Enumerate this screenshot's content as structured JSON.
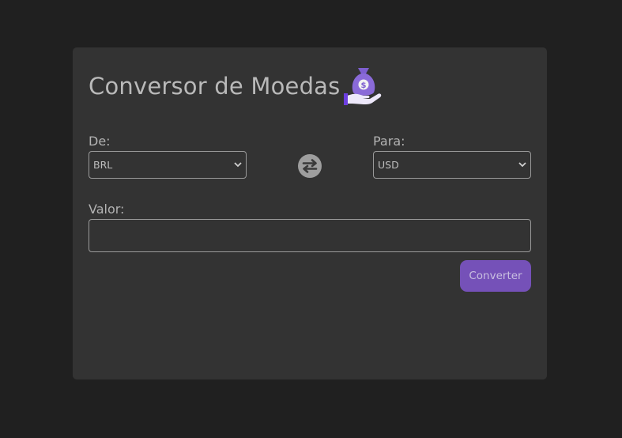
{
  "page": {
    "title": "Conversor de Moedas",
    "title_icon": "money-bag-in-hand-icon"
  },
  "form": {
    "from_label": "De:",
    "from_selected": "BRL",
    "to_label": "Para:",
    "to_selected": "USD",
    "swap_icon": "swap-arrows-icon",
    "value_label": "Valor:",
    "value_input": "",
    "convert_label": "Converter"
  },
  "colors": {
    "background": "#202020",
    "card": "#333333",
    "accent": "#7551b8",
    "text": "#b9b9b9"
  }
}
